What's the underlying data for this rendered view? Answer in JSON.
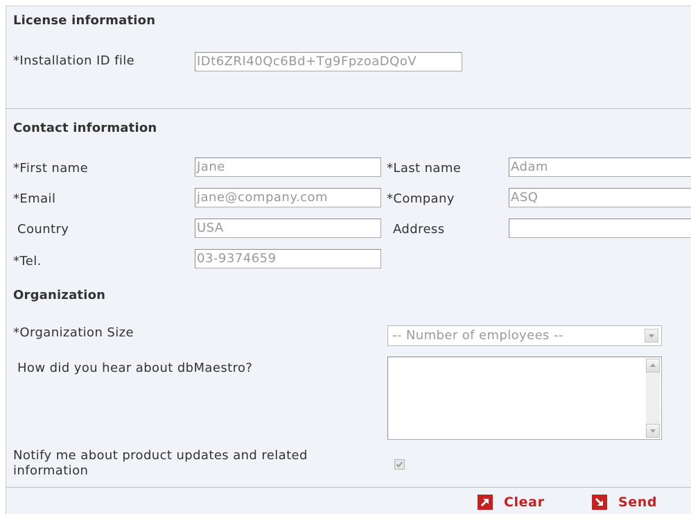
{
  "license": {
    "title": "License information",
    "installation_id_label": "*Installation ID file",
    "installation_id_value": "IDt6ZRI40Qc6Bd+Tg9FpzoaDQoV"
  },
  "contact": {
    "title": "Contact information",
    "first_name_label": "*First name",
    "first_name_value": "Jane",
    "last_name_label": "*Last name",
    "last_name_value": "Adam",
    "email_label": "*Email",
    "email_value": "jane@company.com",
    "company_label": "*Company",
    "company_value": "ASQ",
    "country_label": "Country",
    "country_value": "USA",
    "address_label": "Address",
    "address_value": "",
    "tel_label": "*Tel.",
    "tel_value": "03-9374659"
  },
  "organization": {
    "title": "Organization",
    "size_label": "*Organization Size",
    "size_selected": "-- Number of employees --",
    "hear_label": "How did you hear about dbMaestro?",
    "hear_value": "",
    "notify_label_line1": "Notify me about product updates and related",
    "notify_label_line2": "information",
    "notify_checked": true
  },
  "actions": {
    "clear_label": "Clear",
    "send_label": "Send"
  },
  "colors": {
    "panel_bg": "#f0f3f8",
    "accent_red": "#c62121",
    "input_text": "#999999"
  },
  "icons": {
    "clear": "arrow-up-right-icon",
    "send": "arrow-down-right-icon",
    "checkbox": "checkmark-icon",
    "select": "chevron-down-icon"
  }
}
